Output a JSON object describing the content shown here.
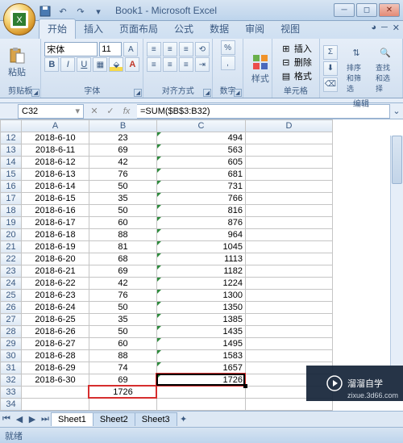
{
  "app": {
    "title": "Book1 - Microsoft Excel"
  },
  "tabs": {
    "home": "开始",
    "insert": "插入",
    "layout": "页面布局",
    "formulas": "公式",
    "data": "数据",
    "review": "审阅",
    "view": "视图"
  },
  "ribbon": {
    "clipboard": {
      "paste": "粘贴",
      "label": "剪贴板"
    },
    "font": {
      "name": "宋体",
      "size": "11",
      "label": "字体"
    },
    "align": {
      "label": "对齐方式"
    },
    "number": {
      "label": "数字"
    },
    "styles": {
      "label": "样式",
      "btn": "样式"
    },
    "cells": {
      "insert": "插入",
      "delete": "删除",
      "format": "格式",
      "label": "单元格"
    },
    "editing": {
      "sort": "排序和筛选",
      "find": "查找和选择",
      "label": "编辑"
    }
  },
  "fx": {
    "cell": "C32",
    "formula": "=SUM($B$3:B32)"
  },
  "columns": [
    "A",
    "B",
    "C",
    "D"
  ],
  "rows": [
    {
      "n": 12,
      "a": "2018-6-10",
      "b": "23",
      "c": "494"
    },
    {
      "n": 13,
      "a": "2018-6-11",
      "b": "69",
      "c": "563"
    },
    {
      "n": 14,
      "a": "2018-6-12",
      "b": "42",
      "c": "605"
    },
    {
      "n": 15,
      "a": "2018-6-13",
      "b": "76",
      "c": "681"
    },
    {
      "n": 16,
      "a": "2018-6-14",
      "b": "50",
      "c": "731"
    },
    {
      "n": 17,
      "a": "2018-6-15",
      "b": "35",
      "c": "766"
    },
    {
      "n": 18,
      "a": "2018-6-16",
      "b": "50",
      "c": "816"
    },
    {
      "n": 19,
      "a": "2018-6-17",
      "b": "60",
      "c": "876"
    },
    {
      "n": 20,
      "a": "2018-6-18",
      "b": "88",
      "c": "964"
    },
    {
      "n": 21,
      "a": "2018-6-19",
      "b": "81",
      "c": "1045"
    },
    {
      "n": 22,
      "a": "2018-6-20",
      "b": "68",
      "c": "1113"
    },
    {
      "n": 23,
      "a": "2018-6-21",
      "b": "69",
      "c": "1182"
    },
    {
      "n": 24,
      "a": "2018-6-22",
      "b": "42",
      "c": "1224"
    },
    {
      "n": 25,
      "a": "2018-6-23",
      "b": "76",
      "c": "1300"
    },
    {
      "n": 26,
      "a": "2018-6-24",
      "b": "50",
      "c": "1350"
    },
    {
      "n": 27,
      "a": "2018-6-25",
      "b": "35",
      "c": "1385"
    },
    {
      "n": 28,
      "a": "2018-6-26",
      "b": "50",
      "c": "1435"
    },
    {
      "n": 29,
      "a": "2018-6-27",
      "b": "60",
      "c": "1495"
    },
    {
      "n": 30,
      "a": "2018-6-28",
      "b": "88",
      "c": "1583"
    },
    {
      "n": 31,
      "a": "2018-6-29",
      "b": "74",
      "c": "1657"
    },
    {
      "n": 32,
      "a": "2018-6-30",
      "b": "69",
      "c": "1726"
    },
    {
      "n": 33,
      "a": "",
      "b": "1726",
      "c": ""
    },
    {
      "n": 34,
      "a": "",
      "b": "",
      "c": ""
    }
  ],
  "sheets": {
    "s1": "Sheet1",
    "s2": "Sheet2",
    "s3": "Sheet3"
  },
  "status": {
    "ready": "就绪"
  },
  "watermark": {
    "brand": "溜溜自学",
    "url": "zixue.3d66.com"
  }
}
